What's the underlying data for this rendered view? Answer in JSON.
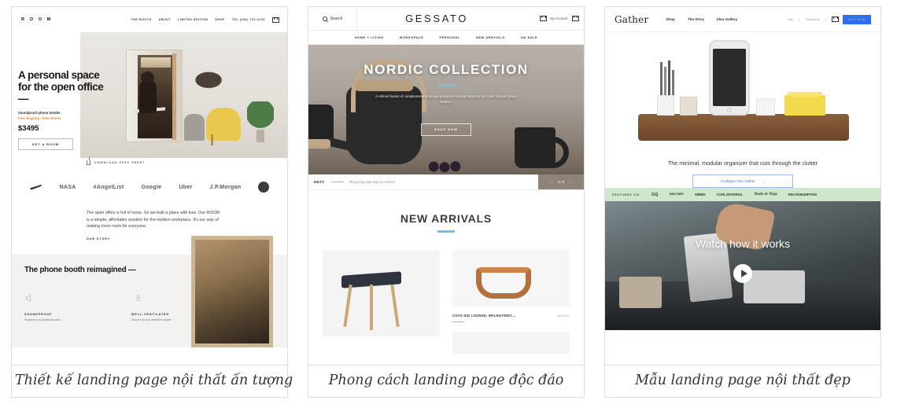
{
  "gallery": {
    "cards": [
      {
        "caption": "Thiết kế landing page nội thất ấn tượng",
        "site": {
          "logo": "R O O M",
          "nav": [
            "THE BOOTH",
            "ABOUT",
            "LIMITED EDITION",
            "SHOP",
            "TEL (646) 791-0136"
          ],
          "cart_icon": "cart-icon",
          "hero": {
            "headline": "A personal space for the open office —",
            "subline": "Soundproof phone booths",
            "shipping": "Free shipping - Free returns",
            "price": "$3495",
            "cta": "GET A ROOM",
            "spec_link": "DOWNLOAD SPEC SHEET",
            "spec_icon": "download-icon"
          },
          "logos": [
            "Nike",
            "NASA",
            "#AngelList",
            "Google",
            "Uber",
            "J.P.Morgan"
          ],
          "body": "The open office is full of noise. So we built a place with less. Our ROOM is a simple, affordable solution for the modern workplace. It's our way of making more room for everyone.",
          "story_link": "OUR STORY",
          "bottom": {
            "headline": "The phone booth reimagined —",
            "features": [
              {
                "icon": "sound-wave-icon",
                "title": "SOUNDPROOF",
                "text": "Engineered by leading acoustic"
              },
              {
                "icon": "fan-icon",
                "title": "WELL-VENTILATED",
                "text": "Discreet fan and ventilation system"
              }
            ]
          }
        }
      },
      {
        "caption": "Phong cách landing page độc đáo",
        "site": {
          "search_label": "Search",
          "search_icon": "search-icon",
          "brand": "GESSATO",
          "account_label": "My Account",
          "wishlist_icon": "heart-icon",
          "cart_icon": "cart-icon",
          "nav": [
            "HOME + LIVING",
            "WORKSPACE",
            "PERSONAL",
            "NEW ARRIVALS",
            "ON SALE"
          ],
          "hero": {
            "headline": "NORDIC COLLECTION",
            "paragraph": "A refined fusion of complementing design principles brought together for iconic Danish brand Stelton.",
            "cta": "SHOP NOW"
          },
          "carousel": {
            "next_label": "NEXT",
            "next_text": "Ping pong your way to connect",
            "counter": "4 / 5",
            "prev_icon": "chevron-left-icon",
            "next_icon": "chevron-right-icon",
            "dots": 5,
            "active_dot": 4
          },
          "section_title": "NEW ARRIVALS",
          "products": [
            {
              "title": "COVO DIG LOUNGE, WALNUT/MOC...",
              "price": "$829.00"
            }
          ]
        }
      },
      {
        "caption": "Mẫu landing page nội thất đẹp",
        "site": {
          "brand": "Gather",
          "nav": [
            "Shop",
            "The Story",
            "Idea Gallery"
          ],
          "utility": [
            "Help",
            "Contact Us"
          ],
          "cart_icon": "cart-icon",
          "buy_label": "BUY NOW",
          "tagline": "The minimal, modular organizer that cuts through the clutter",
          "configure_label": "Configure Your Gather",
          "configure_arrow": "→",
          "featured_label": "FEATURED ON:",
          "featured_logos": [
            "GQ",
            "uncrate",
            "WIRED",
            "COOL MATERIAL",
            "Tools & Toys",
            "RECONSUMPTION"
          ],
          "video": {
            "title": "Watch how it works",
            "play_icon": "play-icon"
          }
        }
      }
    ]
  },
  "colors": {
    "accent_blue": "#6fc3dd",
    "brand_blue": "#2f6fed",
    "orange": "#e8842a",
    "featured_green": "#cfe7cd",
    "border": "#dcdcdc"
  }
}
